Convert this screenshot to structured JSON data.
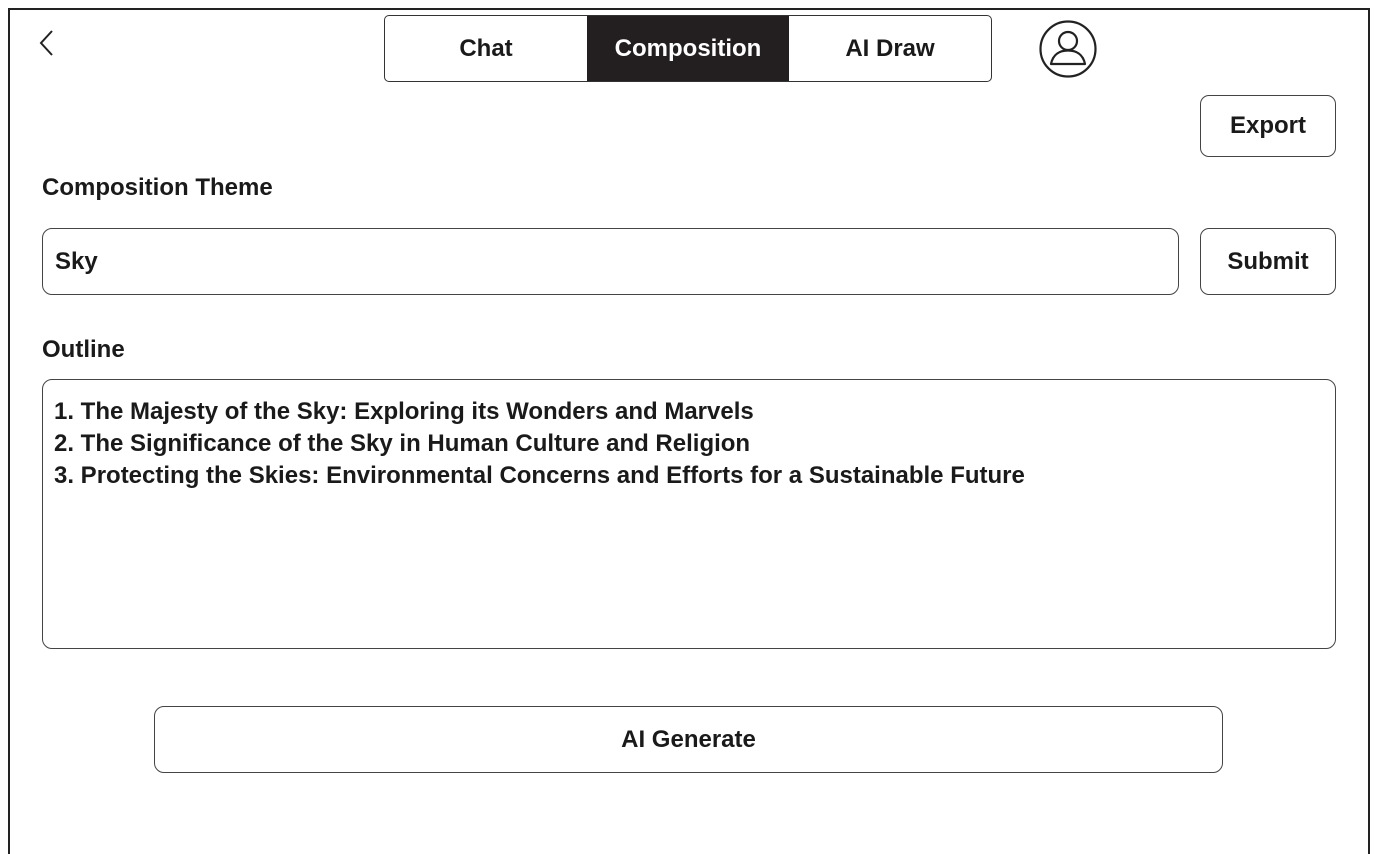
{
  "nav": {
    "back_icon": "chevron-left-icon",
    "tabs": [
      {
        "label": "Chat",
        "active": false
      },
      {
        "label": "Composition",
        "active": true
      },
      {
        "label": "AI Draw",
        "active": false
      }
    ],
    "avatar_icon": "user-profile-icon"
  },
  "toolbar": {
    "export_label": "Export"
  },
  "theme": {
    "label": "Composition Theme",
    "value": "Sky",
    "submit_label": "Submit"
  },
  "outline": {
    "label": "Outline",
    "lines": [
      "1. The Majesty of the Sky: Exploring its Wonders and Marvels",
      "2. The Significance of the Sky in Human Culture and Religion",
      "3. Protecting the Skies: Environmental Concerns and Efforts for a Sustainable Future"
    ]
  },
  "actions": {
    "generate_label": "AI Generate"
  },
  "colors": {
    "active_tab_bg": "#231f20",
    "active_tab_text": "#ffffff",
    "border": "#444444"
  }
}
